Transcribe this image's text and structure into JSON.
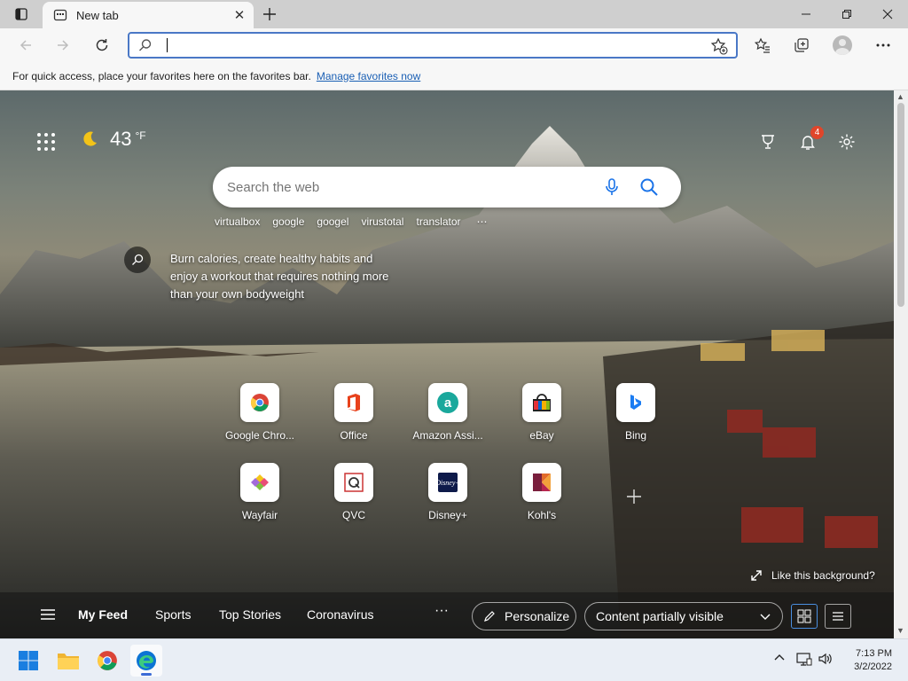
{
  "browser": {
    "tab_title": "New tab",
    "address_placeholder": "",
    "favorites_message": "For quick access, place your favorites here on the favorites bar.",
    "favorites_link": "Manage favorites now"
  },
  "newtab": {
    "weather": {
      "temp": "43",
      "unit": "°F",
      "icon": "moon-icon"
    },
    "notifications_count": "4",
    "search_placeholder": "Search the web",
    "suggestions": [
      "virtualbox",
      "google",
      "googel",
      "virustotal",
      "translator"
    ],
    "suggestions_more": "⋯",
    "promo_text": "Burn calories, create healthy habits and enjoy a workout that requires nothing more than your own bodyweight",
    "quick_links": [
      {
        "label": "Google Chro...",
        "icon": "chrome-icon"
      },
      {
        "label": "Office",
        "icon": "office-icon"
      },
      {
        "label": "Amazon Assi...",
        "icon": "amazon-icon"
      },
      {
        "label": "eBay",
        "icon": "ebay-icon"
      },
      {
        "label": "Bing",
        "icon": "bing-icon"
      },
      {
        "label": "Wayfair",
        "icon": "wayfair-icon"
      },
      {
        "label": "QVC",
        "icon": "qvc-icon"
      },
      {
        "label": "Disney+",
        "icon": "disney-icon"
      },
      {
        "label": "Kohl's",
        "icon": "kohls-icon"
      }
    ],
    "like_background": "Like this background?",
    "feed": {
      "tabs": [
        "My Feed",
        "Sports",
        "Top Stories",
        "Coronavirus"
      ],
      "more": "···",
      "personalize": "Personalize",
      "content_visibility": "Content partially visible"
    }
  },
  "taskbar": {
    "time": "7:13 PM",
    "date": "3/2/2022"
  }
}
